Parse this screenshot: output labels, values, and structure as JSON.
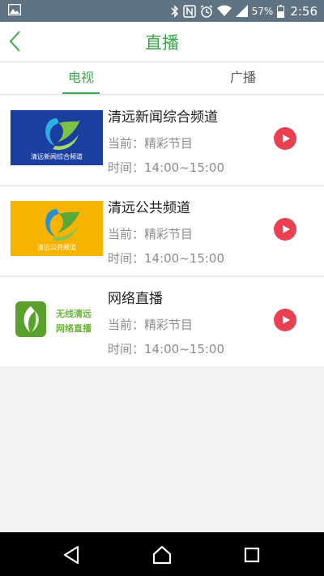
{
  "status_bar": {
    "battery_percent": "57%",
    "time": "2:56",
    "icons": [
      "image-icon",
      "bluetooth-icon",
      "nfc-icon",
      "alarm-icon",
      "wifi-icon",
      "signal-icon",
      "battery-icon"
    ]
  },
  "header": {
    "title": "直播",
    "back_icon": "chevron-left-icon"
  },
  "tabs": [
    {
      "label": "电视",
      "active": true
    },
    {
      "label": "广播",
      "active": false
    }
  ],
  "channels": [
    {
      "name": "清远新闻综合频道",
      "current": "当前：精彩节目",
      "time": "时间：14:00~15:00",
      "logo_text": "清远新闻综合频道",
      "logo_bg": "#1a3fa0"
    },
    {
      "name": "清远公共频道",
      "current": "当前：精彩节目",
      "time": "时间：14:00~15:00",
      "logo_text": "清远公共频道",
      "logo_bg": "#f6b400"
    },
    {
      "name": "网络直播",
      "current": "当前：精彩节目",
      "time": "时间：14:00~15:00",
      "logo_text_line1": "无线清远",
      "logo_text_line2": "网络直播",
      "logo_bg": "#ffffff"
    }
  ],
  "colors": {
    "accent_green": "#3aa84a",
    "play_red": "#e8414f",
    "status_bar": "#5f7382"
  },
  "nav_bar": {
    "icons": [
      "back-triangle-icon",
      "home-icon",
      "recent-apps-icon"
    ]
  }
}
